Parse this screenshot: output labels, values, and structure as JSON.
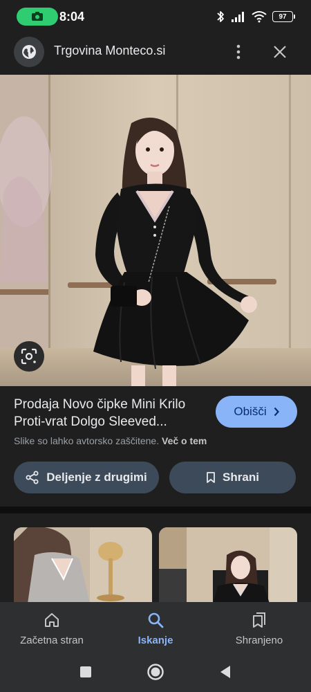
{
  "status_bar": {
    "time": "8:04",
    "battery": "97",
    "icons": [
      "camera-icon",
      "bluetooth-icon",
      "signal-icon",
      "wifi-icon",
      "battery-icon"
    ]
  },
  "header": {
    "site_title": "Trgovina Monteco.si",
    "icons": [
      "globe-icon",
      "more-vert-icon",
      "close-icon"
    ]
  },
  "result": {
    "title_line_1": "Prodaja Novo čipke Mini Krilo",
    "title_line_2": "Proti-vrat Dolgo Sleeved...",
    "visit_label": "Obišči",
    "copyright_text": "Slike so lahko avtorsko zaščitene.",
    "more_link": "Več o tem",
    "share_label": "Deljenje z drugimi",
    "save_label": "Shrani"
  },
  "bottom_nav": {
    "items": [
      {
        "label": "Začetna stran",
        "icon": "home-icon",
        "active": false
      },
      {
        "label": "Iskanje",
        "icon": "search-icon",
        "active": true
      },
      {
        "label": "Shranjeno",
        "icon": "saved-icon",
        "active": false
      }
    ]
  },
  "colors": {
    "background": "#1f1f1f",
    "accent": "#8ab4f8",
    "pill_button": "#3c4a5a",
    "status_pill": "#2fcc71"
  }
}
